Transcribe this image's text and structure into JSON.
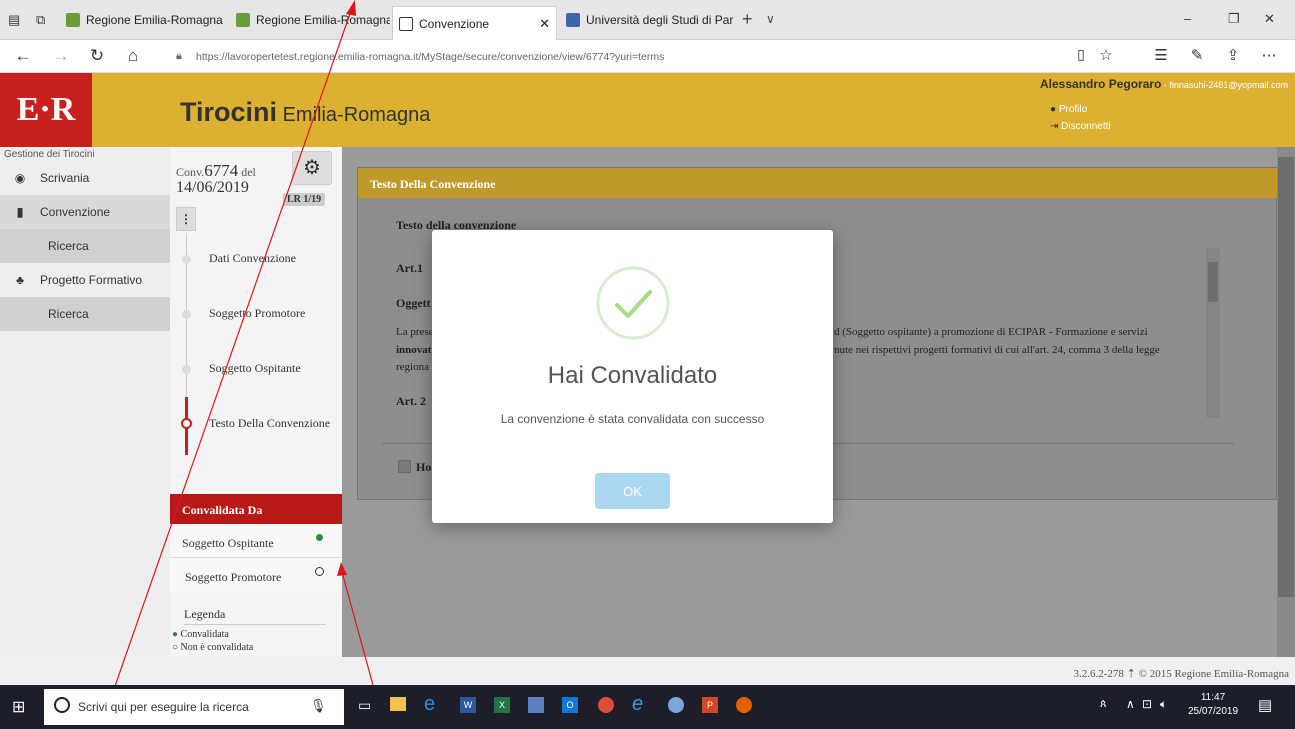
{
  "browser": {
    "tabs": [
      {
        "label": "Regione Emilia-Romagna - I"
      },
      {
        "label": "Regione Emilia-Romagna -"
      },
      {
        "label": "Convenzione"
      },
      {
        "label": "Università degli Studi di Par"
      }
    ],
    "new_tab": "+",
    "tab_menu": "∨",
    "url": "https://lavoropertetest.regione.emilia-romagna.it/MyStage/secure/convenzione/view/6774?yuri=terms",
    "window_controls": {
      "minimize": "–",
      "restore": "❐",
      "close": "✕"
    }
  },
  "header": {
    "logo": "E·R",
    "title_bold": "Tirocini",
    "title_rest": " Emilia-Romagna",
    "user_name": "Alessandro Pegoraro",
    "user_email": " - finnasuhi-2481@yopmail.com",
    "profile_link": "Profilo",
    "logout_link": "Disconnetti"
  },
  "sidebar": {
    "section_title": "Gestione dei Tirocini",
    "items": [
      {
        "label": "Scrivania",
        "icon": "dashboard-icon"
      },
      {
        "label": "Convenzione",
        "icon": "bar-chart-icon"
      },
      {
        "label": "Ricerca",
        "sub": true
      },
      {
        "label": "Progetto Formativo",
        "icon": "users-icon"
      },
      {
        "label": "Ricerca",
        "sub": true
      }
    ]
  },
  "conv": {
    "number_prefix": "Conv.",
    "number": "6774",
    "date_prefix": " del",
    "date": "14/06/2019",
    "law_badge": "LR 1/19",
    "menu_btn": "⋮",
    "steps": [
      {
        "label": "Dati Convenzione"
      },
      {
        "label": "Soggetto Promotore"
      },
      {
        "label": "Soggetto Ospitante"
      },
      {
        "label": "Testo Della Convenzione"
      }
    ],
    "validated_by_title": "Convalidata Da",
    "validated_rows": [
      {
        "label": "Soggetto Ospitante",
        "status": "validated"
      },
      {
        "label": "Soggetto Promotore",
        "status": "not-validated"
      }
    ],
    "legend_title": "Legenda",
    "legend_validated": "Convalidata",
    "legend_not_validated": "Non è convalidata"
  },
  "content": {
    "card_title": "Testo Della Convenzione",
    "heading": "Testo della convenzione",
    "art1": "Art.1",
    "subject": "Oggett",
    "para_start": "La prese",
    "para_start2": "innovat",
    "para_start3": "regiona",
    "para_right1": "d (Soggetto ospitante) a promozione di ECIPAR - Formazione e servizi",
    "para_right2": "nute nei rispettivi progetti formativi di cui all'art. 24, comma 3 della legge",
    "art2": "Art. 2",
    "checkbox_label": "Ho"
  },
  "modal": {
    "title": "Hai Convalidato",
    "message": "La convenzione è stata convalidata con successo",
    "ok_label": "OK"
  },
  "footer": {
    "text": "3.2.6.2-278 ⇡ © 2015 Regione Emilia-Romagna"
  },
  "taskbar": {
    "search_placeholder": "Scrivi qui per eseguire la ricerca",
    "time": "11:47",
    "date": "25/07/2019"
  },
  "colors": {
    "header_gold": "#dcb031",
    "logo_red": "#c8201f",
    "sidebar_active_red": "#b81818",
    "ok_button": "#acd7f1",
    "check_green": "#a5dc86"
  }
}
